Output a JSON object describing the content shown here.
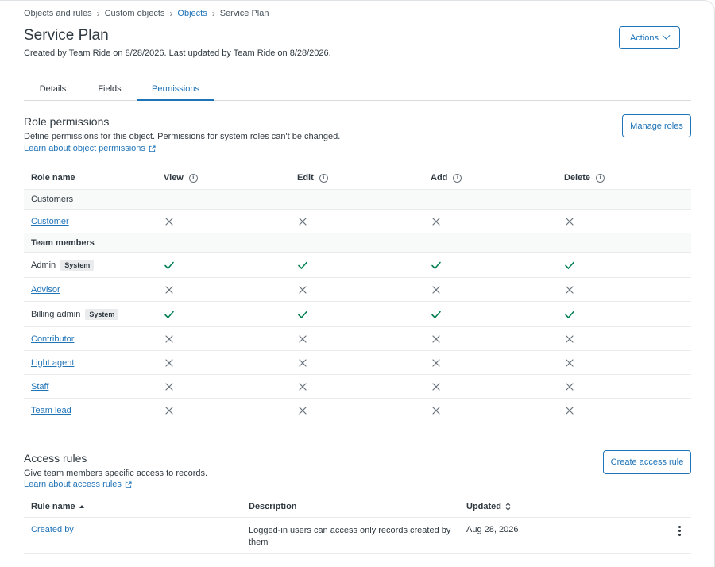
{
  "breadcrumb": {
    "items": [
      "Objects and rules",
      "Custom objects",
      "Objects",
      "Service Plan"
    ]
  },
  "page": {
    "title": "Service Plan",
    "subtitle": "Created by Team Ride on 8/28/2026. Last updated by Team Ride on 8/28/2026.",
    "actions_label": "Actions"
  },
  "tabs": [
    {
      "label": "Details"
    },
    {
      "label": "Fields"
    },
    {
      "label": "Permissions"
    }
  ],
  "role_permissions": {
    "title": "Role permissions",
    "description": "Define permissions for this object. Permissions for system roles can't be changed.",
    "link": "Learn about object permissions",
    "manage_label": "Manage roles",
    "columns": [
      "Role name",
      "View",
      "Edit",
      "Add",
      "Delete"
    ],
    "groups": [
      {
        "label": "Customers",
        "rows": [
          {
            "role": "Customer",
            "badge": "",
            "perms": [
              "no",
              "no",
              "no",
              "no"
            ]
          }
        ]
      },
      {
        "label": "Team members",
        "rows": [
          {
            "role": "Admin",
            "badge": "System",
            "perms": [
              "yes",
              "yes",
              "yes",
              "yes"
            ]
          },
          {
            "role": "Advisor",
            "badge": "",
            "perms": [
              "no",
              "no",
              "no",
              "no"
            ]
          },
          {
            "role": "Billing admin",
            "badge": "System",
            "perms": [
              "yes",
              "yes",
              "yes",
              "yes"
            ]
          },
          {
            "role": "Contributor",
            "badge": "",
            "perms": [
              "no",
              "no",
              "no",
              "no"
            ]
          },
          {
            "role": "Light agent",
            "badge": "",
            "perms": [
              "no",
              "no",
              "no",
              "no"
            ]
          },
          {
            "role": "Staff",
            "badge": "",
            "perms": [
              "no",
              "no",
              "no",
              "no"
            ]
          },
          {
            "role": "Team lead",
            "badge": "",
            "perms": [
              "no",
              "no",
              "no",
              "no"
            ]
          }
        ]
      }
    ]
  },
  "access_rules": {
    "title": "Access rules",
    "description": "Give team members specific access to records.",
    "link": "Learn about access rules",
    "create_label": "Create access rule",
    "columns": [
      "Rule name",
      "Description",
      "Updated"
    ],
    "rows": [
      {
        "name": "Created by",
        "description": "Logged-in users can access only records created by them",
        "updated": "Aug 28, 2026"
      }
    ]
  },
  "colors": {
    "accent": "#1f73b7",
    "check": "#038153",
    "cross": "#68737d",
    "text": "#2f3941"
  }
}
